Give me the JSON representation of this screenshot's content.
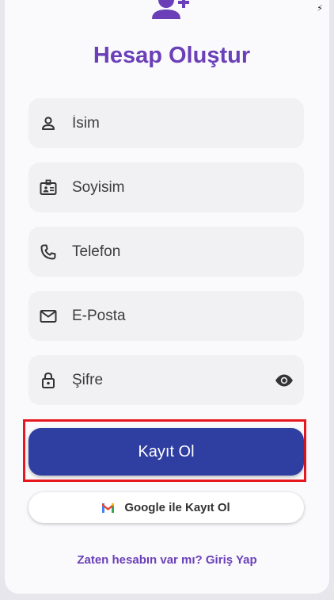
{
  "status": {
    "charging_icon": "bolt-icon"
  },
  "header": {
    "icon": "person-add-icon",
    "title": "Hesap Oluştur"
  },
  "form": {
    "fields": [
      {
        "icon": "person-icon",
        "placeholder": "İsim"
      },
      {
        "icon": "badge-icon",
        "placeholder": "Soyisim"
      },
      {
        "icon": "phone-icon",
        "placeholder": "Telefon"
      },
      {
        "icon": "mail-icon",
        "placeholder": "E-Posta"
      },
      {
        "icon": "lock-icon",
        "placeholder": "Şifre",
        "trailing_icon": "visibility-icon"
      }
    ],
    "submit_label": "Kayıt Ol",
    "google_label": "Google ile Kayıt Ol",
    "login_prompt": "Zaten hesabın var mı? Giriş Yap"
  },
  "colors": {
    "accent": "#6a3fb8",
    "primary_button": "#2f3ea1",
    "field_bg": "#f1f1f3",
    "highlight": "#e8161f"
  }
}
